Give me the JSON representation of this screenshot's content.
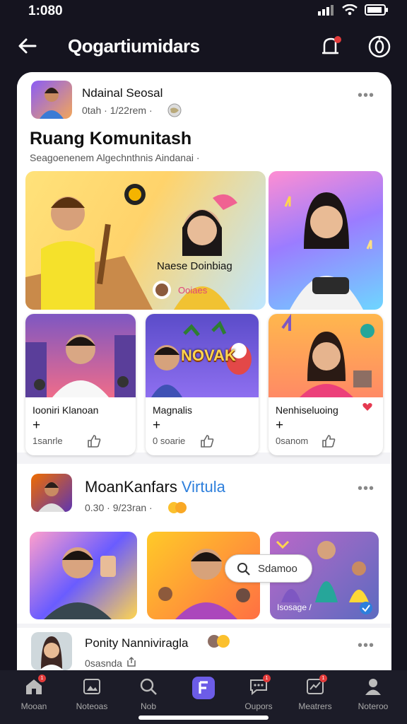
{
  "status": {
    "time": "1:080"
  },
  "header": {
    "title": "Qogartiumidars"
  },
  "post1": {
    "author": "Ndainal Seosal",
    "meta": "0tah · 1/22rem ·",
    "title": "Ruang Komunitash",
    "subtitle": "Seagoenenem Algechnthnis Aindanai ·",
    "hero_label": "Naese Doinbiag",
    "hero_sublabel": "Ooiaes",
    "cards": [
      {
        "name": "Iooniri Klanoan",
        "plus": "+",
        "stat": "1sanrle"
      },
      {
        "name": "Magnalis",
        "plus": "+",
        "stat": "0 soarie"
      },
      {
        "name": "Nenhiseluoing",
        "plus": "+",
        "stat": "0sanom"
      }
    ],
    "game_logo": "NOVAK"
  },
  "post2": {
    "author_a": "MoanKanfars",
    "author_b": "Virtula",
    "meta": "0.30 · 9/23ran ·",
    "tile_caption": "Isosage /"
  },
  "post3": {
    "author": "Ponity Nanniviragla",
    "meta": "0sasnda",
    "search_label": "Sdamoo"
  },
  "tabs": [
    {
      "label": "Mooan"
    },
    {
      "label": "Noteoas"
    },
    {
      "label": "Nob"
    },
    {
      "label": ""
    },
    {
      "label": "Oupors"
    },
    {
      "label": "Meatrers"
    },
    {
      "label": "Noteroo"
    }
  ],
  "colors": {
    "accent": "#6c5ce7",
    "accent_blue": "#2d7fdc",
    "badge": "#e23b3b",
    "background": "#15141f"
  }
}
